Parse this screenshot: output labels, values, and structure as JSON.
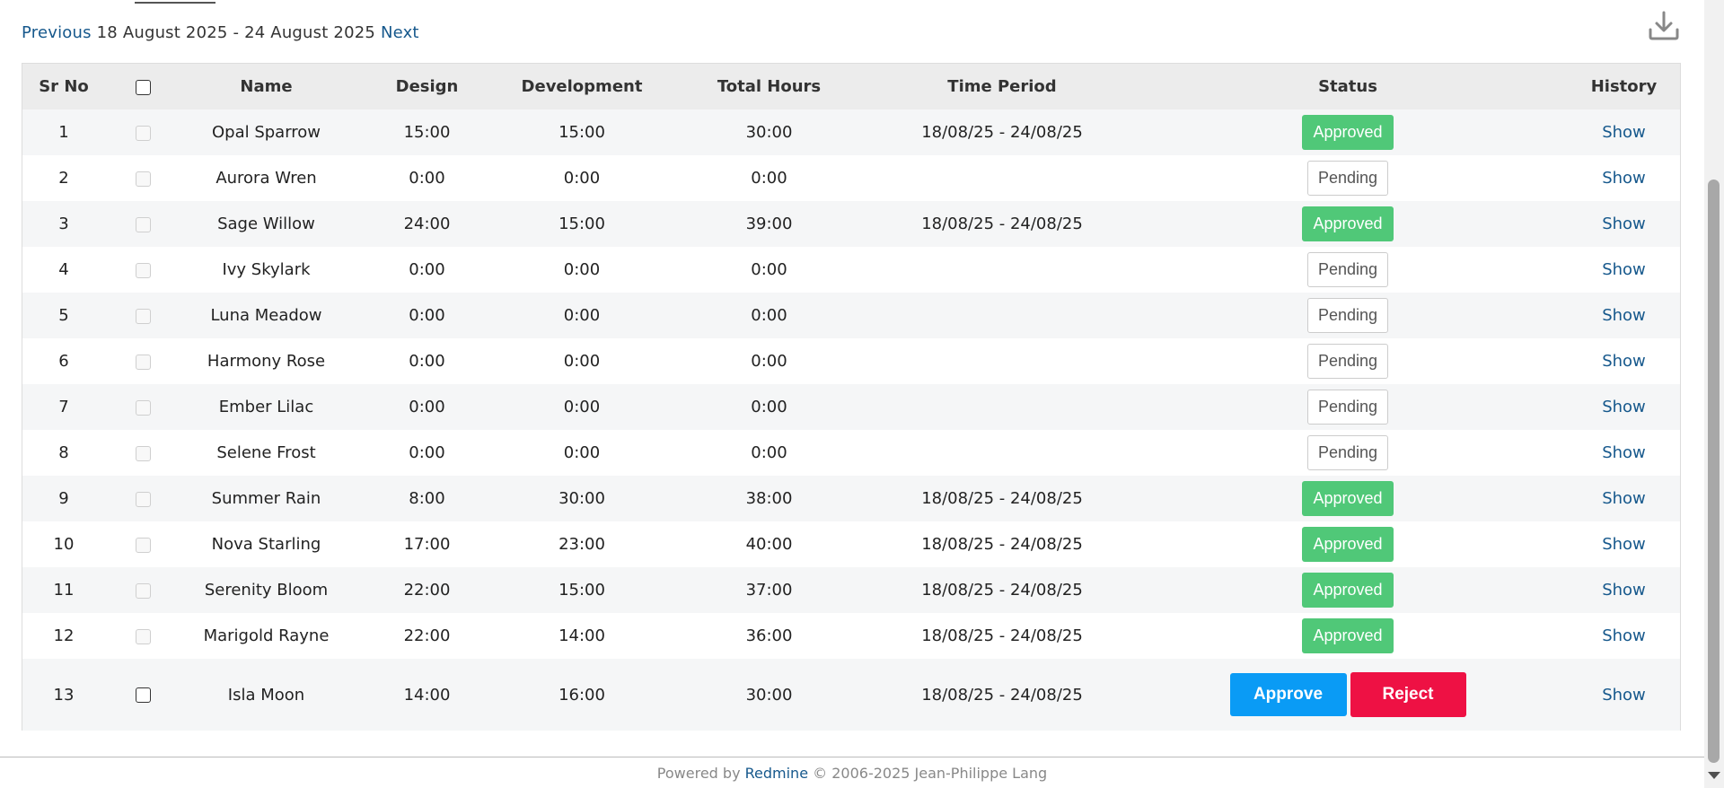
{
  "nav": {
    "previous": "Previous",
    "range": "18 August 2025 - 24 August 2025",
    "next": "Next"
  },
  "icons": {
    "download": "download-icon"
  },
  "table": {
    "headers": {
      "sr_no": "Sr No",
      "name": "Name",
      "design": "Design",
      "development": "Development",
      "total_hours": "Total Hours",
      "time_period": "Time Period",
      "status": "Status",
      "history": "History"
    },
    "rows": [
      {
        "sr": "1",
        "name": "Opal Sparrow",
        "design": "15:00",
        "development": "15:00",
        "total": "30:00",
        "period": "18/08/25 - 24/08/25",
        "status": "Approved",
        "history": "Show"
      },
      {
        "sr": "2",
        "name": "Aurora Wren",
        "design": "0:00",
        "development": "0:00",
        "total": "0:00",
        "period": "",
        "status": "Pending",
        "history": "Show"
      },
      {
        "sr": "3",
        "name": "Sage Willow",
        "design": "24:00",
        "development": "15:00",
        "total": "39:00",
        "period": "18/08/25 - 24/08/25",
        "status": "Approved",
        "history": "Show"
      },
      {
        "sr": "4",
        "name": "Ivy Skylark",
        "design": "0:00",
        "development": "0:00",
        "total": "0:00",
        "period": "",
        "status": "Pending",
        "history": "Show"
      },
      {
        "sr": "5",
        "name": "Luna Meadow",
        "design": "0:00",
        "development": "0:00",
        "total": "0:00",
        "period": "",
        "status": "Pending",
        "history": "Show"
      },
      {
        "sr": "6",
        "name": "Harmony Rose",
        "design": "0:00",
        "development": "0:00",
        "total": "0:00",
        "period": "",
        "status": "Pending",
        "history": "Show"
      },
      {
        "sr": "7",
        "name": "Ember Lilac",
        "design": "0:00",
        "development": "0:00",
        "total": "0:00",
        "period": "",
        "status": "Pending",
        "history": "Show"
      },
      {
        "sr": "8",
        "name": "Selene Frost",
        "design": "0:00",
        "development": "0:00",
        "total": "0:00",
        "period": "",
        "status": "Pending",
        "history": "Show"
      },
      {
        "sr": "9",
        "name": "Summer Rain",
        "design": "8:00",
        "development": "30:00",
        "total": "38:00",
        "period": "18/08/25 - 24/08/25",
        "status": "Approved",
        "history": "Show"
      },
      {
        "sr": "10",
        "name": "Nova Starling",
        "design": "17:00",
        "development": "23:00",
        "total": "40:00",
        "period": "18/08/25 - 24/08/25",
        "status": "Approved",
        "history": "Show"
      },
      {
        "sr": "11",
        "name": "Serenity Bloom",
        "design": "22:00",
        "development": "15:00",
        "total": "37:00",
        "period": "18/08/25 - 24/08/25",
        "status": "Approved",
        "history": "Show"
      },
      {
        "sr": "12",
        "name": "Marigold Rayne",
        "design": "22:00",
        "development": "14:00",
        "total": "36:00",
        "period": "18/08/25 - 24/08/25",
        "status": "Approved",
        "history": "Show"
      },
      {
        "sr": "13",
        "name": "Isla Moon",
        "design": "14:00",
        "development": "16:00",
        "total": "30:00",
        "period": "18/08/25 - 24/08/25",
        "status": "",
        "history": "Show"
      }
    ]
  },
  "actions": {
    "approve": "Approve",
    "reject": "Reject"
  },
  "footer": {
    "powered_by": "Powered by",
    "redmine": "Redmine",
    "copyright": "© 2006-2025 Jean-Philippe Lang"
  },
  "colors": {
    "link": "#16588c",
    "approved": "#50c878",
    "approve_button": "#0a9bf5",
    "reject_button": "#ee1144"
  }
}
